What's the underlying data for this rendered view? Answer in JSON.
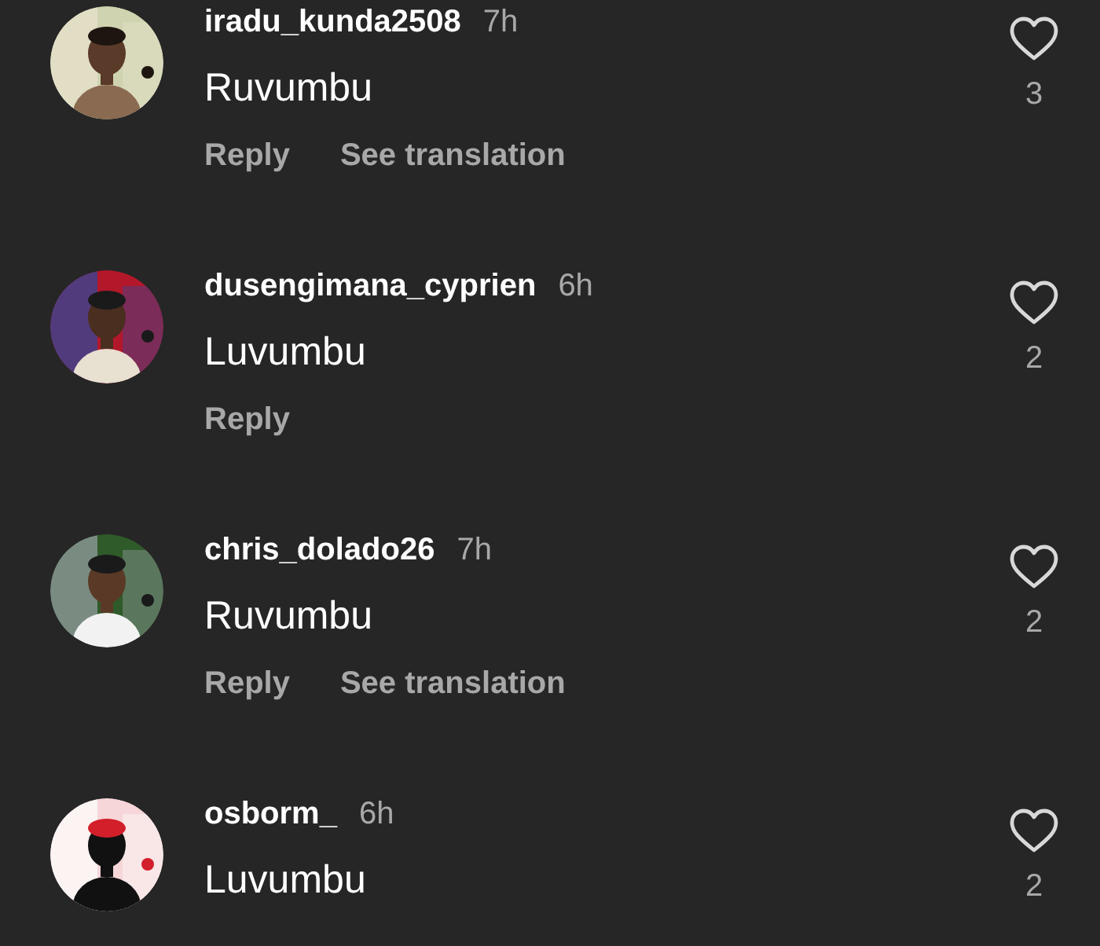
{
  "comments": [
    {
      "username": "iradu_kunda2508",
      "time": "7h",
      "text": "Ruvumbu",
      "liked": false,
      "likes": "3",
      "actions": [
        "Reply",
        "See translation"
      ]
    },
    {
      "username": "dusengimana_cyprien",
      "time": "6h",
      "text": "Luvumbu",
      "liked": false,
      "likes": "2",
      "actions": [
        "Reply"
      ]
    },
    {
      "username": "chris_dolado26",
      "time": "7h",
      "text": "Ruvumbu",
      "liked": false,
      "likes": "2",
      "actions": [
        "Reply",
        "See translation"
      ]
    },
    {
      "username": "osborm_",
      "time": "6h",
      "text": "Luvumbu",
      "liked": false,
      "likes": "2"
    }
  ]
}
